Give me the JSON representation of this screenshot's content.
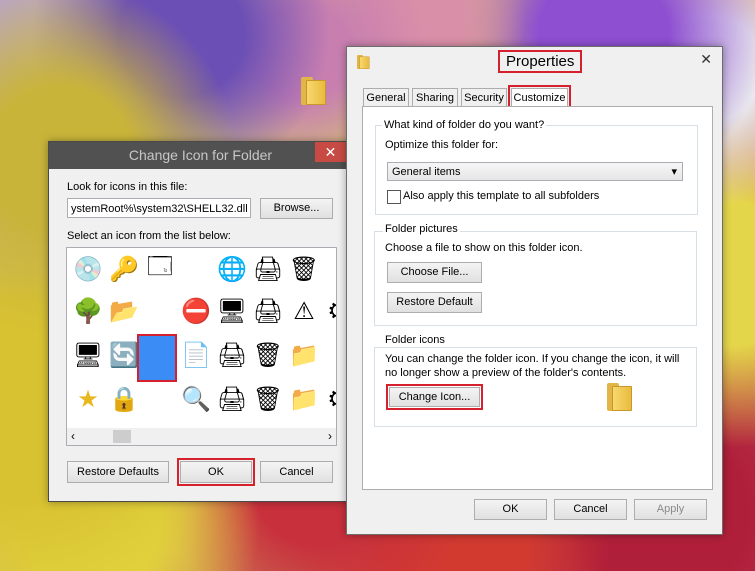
{
  "change_icon": {
    "title": "Change Icon for   Folder",
    "close_glyph": "✕",
    "look_label": "Look for icons in this file:",
    "path_value": "ystemRoot%\\system32\\SHELL32.dll",
    "browse_label": "Browse...",
    "select_label": "Select an icon from the list below:",
    "scroll_left": "‹",
    "scroll_right": "›",
    "restore_label": "Restore Defaults",
    "ok_label": "OK",
    "cancel_label": "Cancel",
    "icons": [
      {
        "name": "cd-drive-icon",
        "glyph": "💿"
      },
      {
        "name": "key-icon",
        "glyph": "🔑"
      },
      {
        "name": "run-window-icon",
        "glyph": "🗔"
      },
      {
        "name": "globe-search-icon",
        "glyph": "🌐"
      },
      {
        "name": "printer-icon",
        "glyph": "🖨"
      },
      {
        "name": "recycle-bin-icon",
        "glyph": "🗑"
      },
      {
        "name": "tree-icon",
        "glyph": "🌳"
      },
      {
        "name": "folder-arrow-icon",
        "glyph": "📂"
      },
      {
        "name": "drive-error-icon",
        "glyph": "⛔"
      },
      {
        "name": "control-panel-icon",
        "glyph": "🖥"
      },
      {
        "name": "printer-icon",
        "glyph": "🖨"
      },
      {
        "name": "warning-icon",
        "glyph": "⚠"
      },
      {
        "name": "gear-icon",
        "glyph": "⚙"
      },
      {
        "name": "computer-folder-icon",
        "glyph": "🖥"
      },
      {
        "name": "network-sync-icon",
        "glyph": "🔄"
      },
      {
        "name": "documents-icon",
        "glyph": "📄"
      },
      {
        "name": "printer-icon",
        "glyph": "🖨"
      },
      {
        "name": "recycle-bin-icon",
        "glyph": "🗑"
      },
      {
        "name": "folder-warning-icon",
        "glyph": "📁"
      },
      {
        "name": "star-icon",
        "glyph": "★"
      },
      {
        "name": "lock-icon",
        "glyph": "🔒"
      },
      {
        "name": "magnifier-icon",
        "glyph": "🔍"
      },
      {
        "name": "printer-add-icon",
        "glyph": "🖨"
      },
      {
        "name": "recycle-bin-icon",
        "glyph": "🗑"
      },
      {
        "name": "folder-edit-icon",
        "glyph": "📁"
      },
      {
        "name": "gear-icon",
        "glyph": "⚙"
      }
    ]
  },
  "properties": {
    "title": "Properties",
    "close_glyph": "✕",
    "tabs": [
      "General",
      "Sharing",
      "Security",
      "Customize"
    ],
    "group1_label": "What kind of folder do you want?",
    "optimize_label": "Optimize this folder for:",
    "optimize_value": "General items",
    "chevron": "▾",
    "subfolders_label": "Also apply this template to all subfolders",
    "group2_label": "Folder pictures",
    "pictures_desc": "Choose a file to show on this folder icon.",
    "choose_file_label": "Choose File...",
    "restore_default_label": "Restore Default",
    "group3_label": "Folder icons",
    "icons_desc_1": "You can change the folder icon. If you change the icon, it will",
    "icons_desc_2": "no longer show a preview of the folder's contents.",
    "change_icon_label": "Change Icon...",
    "ok_label": "OK",
    "cancel_label": "Cancel",
    "apply_label": "Apply"
  },
  "colors": {
    "highlight": "#d6202e",
    "selected_icon": "#3c8cf5"
  }
}
